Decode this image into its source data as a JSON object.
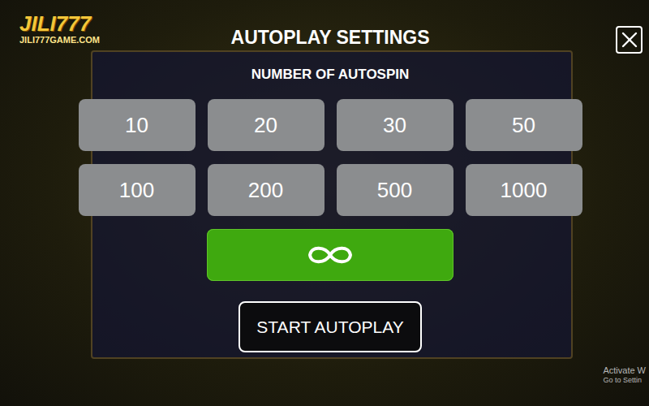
{
  "logo": {
    "title": "JILI777",
    "subtitle": "JILI777GAME.COM"
  },
  "dialog": {
    "title": "AUTOPLAY SETTINGS",
    "subtitle": "NUMBER OF AUTOSPIN",
    "options": [
      {
        "label": "10",
        "selected": false
      },
      {
        "label": "20",
        "selected": false
      },
      {
        "label": "30",
        "selected": false
      },
      {
        "label": "50",
        "selected": false
      },
      {
        "label": "100",
        "selected": false
      },
      {
        "label": "200",
        "selected": false
      },
      {
        "label": "500",
        "selected": false
      },
      {
        "label": "1000",
        "selected": false
      }
    ],
    "infinite": {
      "selected": true
    },
    "start_button": "START AUTOPLAY"
  },
  "watermark": [
    "Activate W",
    "Go to Settin"
  ]
}
